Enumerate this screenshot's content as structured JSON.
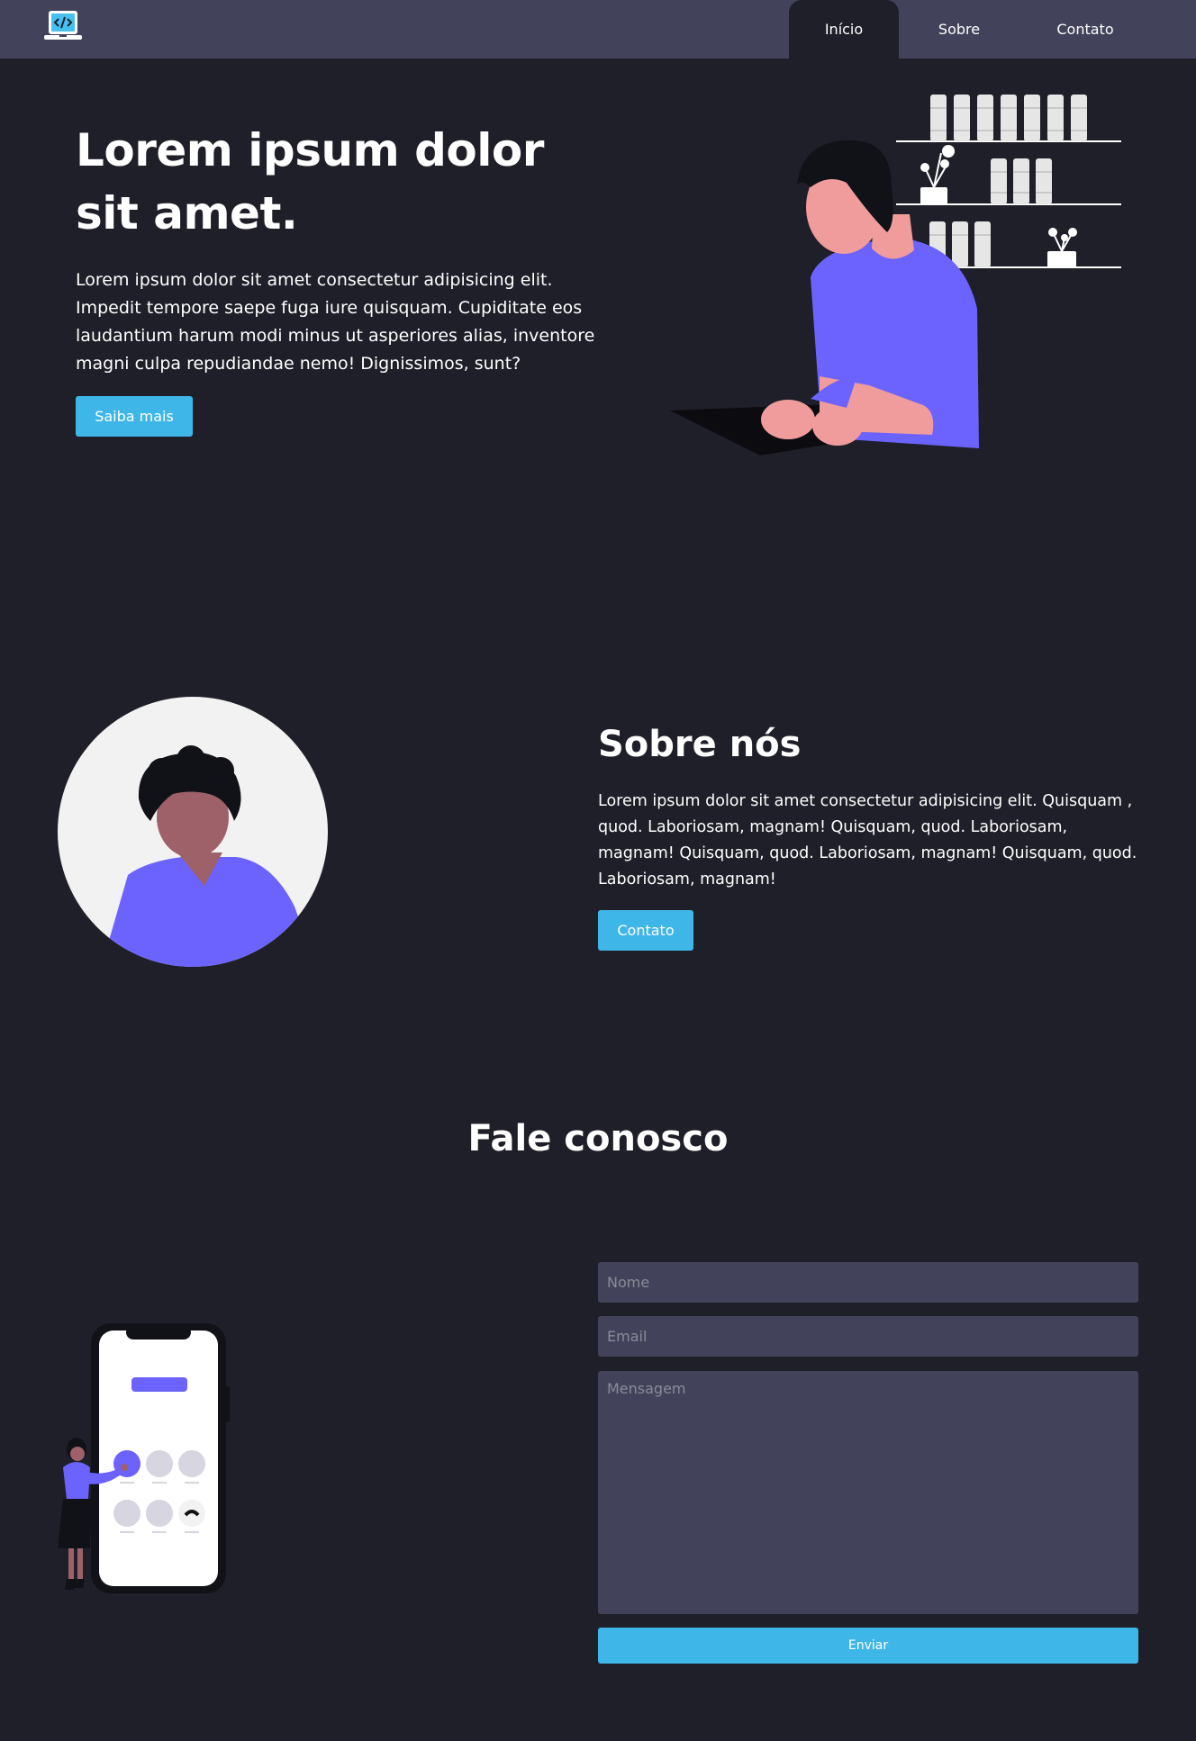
{
  "nav": {
    "items": [
      {
        "label": "Início",
        "active": true
      },
      {
        "label": "Sobre",
        "active": false
      },
      {
        "label": "Contato",
        "active": false
      }
    ]
  },
  "hero": {
    "title": "Lorem ipsum dolor sit amet.",
    "text": "Lorem ipsum dolor sit amet consectetur adipisicing elit. Impedit tempore saepe fuga iure quisquam. Cupiditate eos laudantium harum modi minus ut asperiores alias, inventore magni culpa repudiandae nemo! Dignissimos, sunt?",
    "button_label": "Saiba mais"
  },
  "about": {
    "title": "Sobre nós",
    "text": "Lorem ipsum dolor sit amet consectetur adipisicing elit. Quisquam , quod. Laboriosam, magnam! Quisquam, quod. Laboriosam, magnam! Quisquam, quod. Laboriosam, magnam! Quisquam, quod. Laboriosam, magnam!",
    "button_label": "Contato"
  },
  "contact": {
    "title": "Fale conosco",
    "name_placeholder": "Nome",
    "email_placeholder": "Email",
    "message_placeholder": "Mensagem",
    "submit_label": "Enviar"
  },
  "colors": {
    "background": "#1f1f29",
    "nav_background": "#42435a",
    "accent": "#3fb6e8",
    "illustration_purple": "#6c63ff",
    "skin": "#f09c9c"
  },
  "icons": {
    "logo": "laptop-code-icon"
  }
}
